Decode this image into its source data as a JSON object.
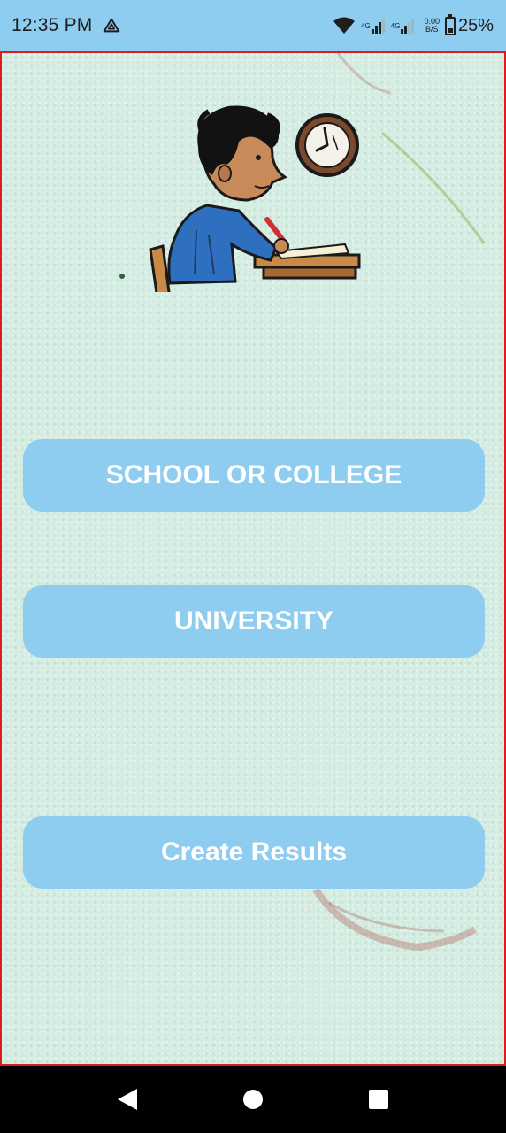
{
  "status_bar": {
    "time": "12:35 PM",
    "network_type_1": "4G",
    "network_type_2": "4G",
    "net_speed_value": "0.00",
    "net_speed_unit": "B/S",
    "battery": "25%",
    "battery_level": 0.25,
    "icons": [
      "drive-icon",
      "wifi-icon",
      "signal-icon",
      "signal-icon",
      "battery-icon"
    ]
  },
  "main": {
    "illustration": "student-writing-at-desk-with-clock",
    "buttons": {
      "school": "SCHOOL OR COLLEGE",
      "university": "UNIVERSITY",
      "results": "Create Results"
    }
  },
  "nav_bar": {
    "icons": [
      "back-icon",
      "home-icon",
      "recents-icon"
    ]
  },
  "colors": {
    "status_bar_bg": "#8fcdf0",
    "button_bg": "#8fcdf0",
    "button_text": "#ffffff",
    "content_bg": "#d4ece2",
    "frame_border": "#e01b1b"
  }
}
